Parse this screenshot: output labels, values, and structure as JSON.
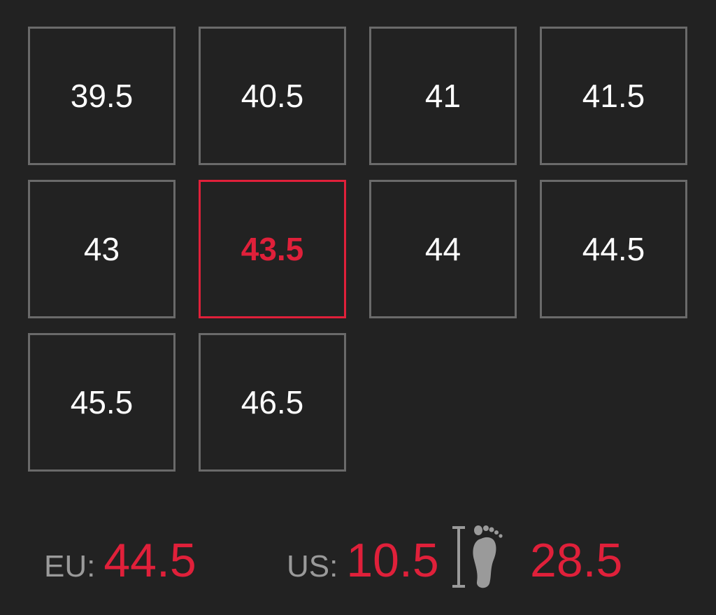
{
  "sizes": [
    {
      "label": "39.5",
      "selected": false
    },
    {
      "label": "40.5",
      "selected": false
    },
    {
      "label": "41",
      "selected": false
    },
    {
      "label": "41.5",
      "selected": false
    },
    {
      "label": "43",
      "selected": false
    },
    {
      "label": "43.5",
      "selected": true
    },
    {
      "label": "44",
      "selected": false
    },
    {
      "label": "44.5",
      "selected": false
    },
    {
      "label": "45.5",
      "selected": false
    },
    {
      "label": "46.5",
      "selected": false
    }
  ],
  "conversion": {
    "eu_label": "EU:",
    "eu_value": "44.5",
    "us_label": "US:",
    "us_value": "10.5",
    "foot_icon": "foot-length-icon",
    "cm_value": "28.5"
  },
  "colors": {
    "background": "#222222",
    "accent": "#e0203a",
    "cell_border": "#6a6a6a",
    "muted_text": "#9a9a9a"
  }
}
